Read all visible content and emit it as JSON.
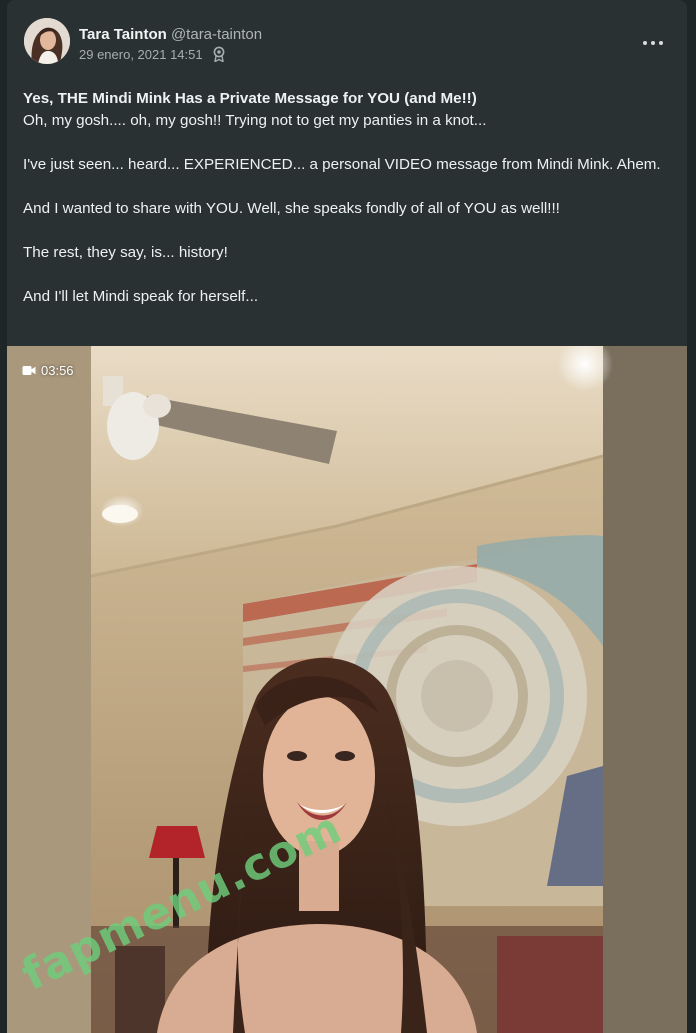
{
  "post": {
    "author": {
      "display_name": "Tara Tainton",
      "handle": "@tara-tainton",
      "avatar_icon": "avatar-photo"
    },
    "timestamp": "29 enero, 2021 14:51",
    "badge_icon": "award-ribbon-icon",
    "menu_icon": "more-options-icon",
    "title": "Yes, THE Mindi Mink Has a Private Message for YOU (and Me!!)",
    "paragraphs": [
      "Oh, my gosh.... oh, my gosh!! Trying not to get my panties in a knot...",
      "I've just seen... heard... EXPERIENCED... a personal VIDEO message from Mindi Mink. Ahem.",
      "And I wanted to share with YOU. Well, she speaks fondly of all of YOU as well!!!",
      "The rest, they say, is... history!",
      "And I'll let Mindi speak for herself..."
    ]
  },
  "media": {
    "type": "video",
    "duration": "03:56",
    "duration_icon": "video-camera-icon",
    "watermark": "fapmenu.com"
  },
  "colors": {
    "page_bg": "#1f2628",
    "card_bg": "#2a3133",
    "text_primary": "#eef1f1",
    "text_secondary": "#a7aeaf",
    "watermark": "#6ecd7d"
  }
}
